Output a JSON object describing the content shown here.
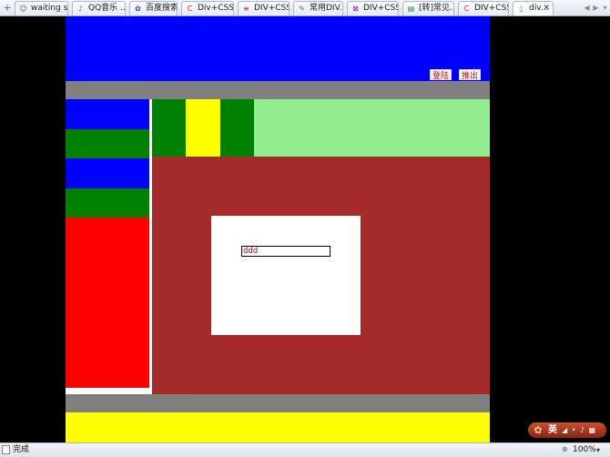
{
  "browser": {
    "tabs": [
      {
        "label": "waiting s...",
        "icon": "globe-icon",
        "glyph": "☺",
        "color": "#2a7a2a"
      },
      {
        "label": "QQ音乐 ...",
        "icon": "qq-music-icon",
        "glyph": "♪",
        "color": "#1a9a3a"
      },
      {
        "label": "百度搜索...",
        "icon": "baidu-icon",
        "glyph": "✿",
        "color": "#2a3bd0"
      },
      {
        "label": "Div+CSS...",
        "icon": "refresh-logo-icon",
        "glyph": "C",
        "color": "#d02020"
      },
      {
        "label": "DIV+CSS...",
        "icon": "document-icon",
        "glyph": "≡",
        "color": "#c03030"
      },
      {
        "label": "常用DIV...",
        "icon": "pencil-icon",
        "glyph": "✎",
        "color": "#2f6fb0"
      },
      {
        "label": "DIV+CSS...",
        "icon": "bookmark-icon",
        "glyph": "⊠",
        "color": "#7a2a7a"
      },
      {
        "label": "[转]常见...",
        "icon": "grid-icon",
        "glyph": "▤",
        "color": "#2a8a4a"
      },
      {
        "label": "DIV+CSS...",
        "icon": "refresh-logo-icon",
        "glyph": "C",
        "color": "#d02020"
      },
      {
        "label": "div...",
        "icon": "blank-page-icon",
        "glyph": "▯",
        "color": "#6a7a8a",
        "active": true
      }
    ],
    "status_text": "完成",
    "zoom": "100%"
  },
  "page": {
    "header": {
      "login_label": "登陆",
      "logout_label": "推出"
    },
    "form": {
      "input_value": "ddd"
    }
  },
  "ime": {
    "mode": "英",
    "icons": "◢ • ♪ ▦"
  }
}
